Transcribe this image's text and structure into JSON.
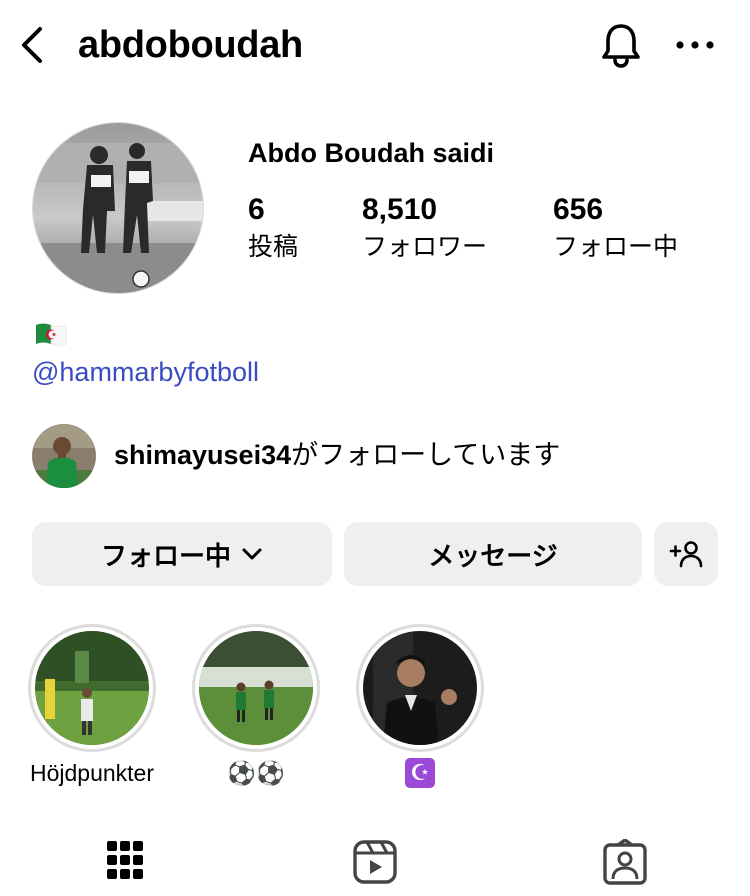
{
  "header": {
    "username": "abdoboudah"
  },
  "profile": {
    "full_name": "Abdo Boudah saidi",
    "stats": [
      {
        "value": "6",
        "label": "投稿"
      },
      {
        "value": "8,510",
        "label": "フォロワー"
      },
      {
        "value": "656",
        "label": "フォロー中"
      }
    ],
    "bio_link": "@hammarbyfotboll"
  },
  "mutual": {
    "username": "shimayusei34",
    "text": "がフォローしています"
  },
  "actions": {
    "following_label": "フォロー中",
    "message_label": "メッセージ"
  },
  "highlights": [
    {
      "label": "Höjdpunkter"
    },
    {
      "label": "⚽⚽"
    },
    {
      "label": "☪"
    }
  ],
  "colors": {
    "link": "#3b4cc0",
    "button_bg": "#efefef",
    "ring": "#dcdcdc"
  }
}
